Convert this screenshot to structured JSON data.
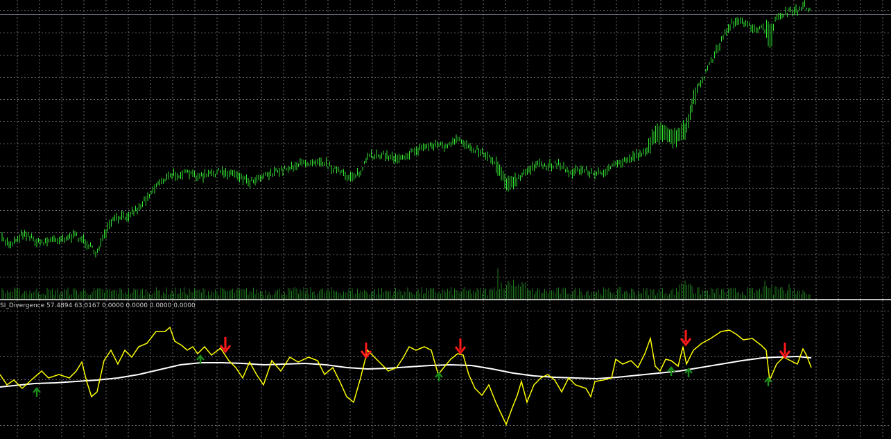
{
  "colors": {
    "background": "#000000",
    "grid": "#6e6e6e",
    "candles": "#33e633",
    "volume": "#1f7a1f",
    "separator": "#bfbfbf",
    "rsi_line": "#ffff00",
    "ma_line": "#ffffff",
    "sell_arrow": "#ff1a1a",
    "buy_arrow": "#1a8c1a"
  },
  "indicator": {
    "label": "SI_Divergence 57.4894 63.0167 0.0000 0.0000 0.0000 0.0000"
  },
  "icons": {
    "sell_signal": "red-down-arrow-icon",
    "buy_signal": "green-up-arrow-icon"
  }
}
